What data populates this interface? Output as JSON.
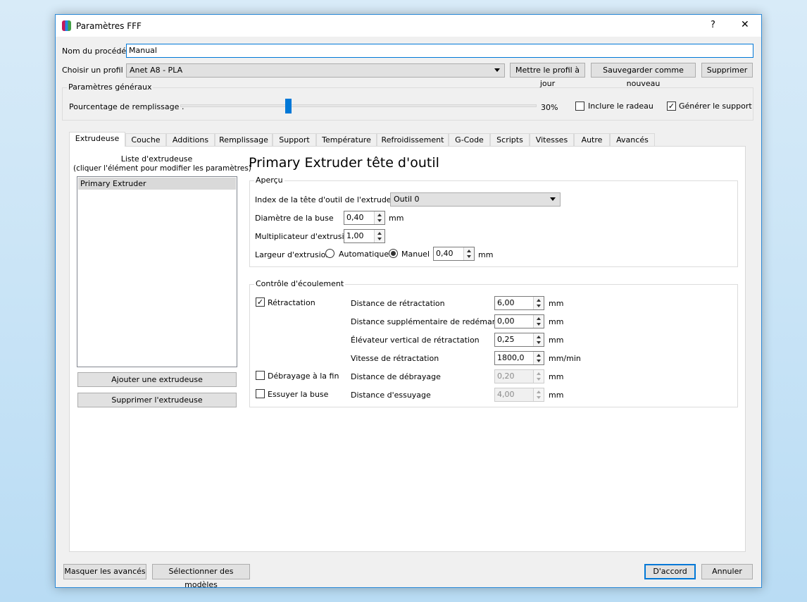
{
  "window": {
    "title": "Paramètres FFF",
    "help": "?",
    "close": "✕"
  },
  "process_name": {
    "label": "Nom du procédé :",
    "value": "Manual"
  },
  "profile": {
    "label": "Choisir un profil :",
    "value": "Anet A8 - PLA",
    "update": "Mettre le profil à jour",
    "save_new": "Sauvegarder comme nouveau",
    "delete": "Supprimer"
  },
  "general": {
    "title": "Paramètres généraux",
    "infill_label": "Pourcentage de remplissage :",
    "infill_value": "30%",
    "infill_percent": 30,
    "raft_label": "Inclure le radeau",
    "raft_checked": false,
    "support_label": "Générer le support",
    "support_checked": true
  },
  "tabs": [
    "Extrudeuse",
    "Couche",
    "Additions",
    "Remplissage",
    "Support",
    "Température",
    "Refroidissement",
    "G-Code",
    "Scripts",
    "Vitesses",
    "Autre",
    "Avancés"
  ],
  "extruder_list": {
    "header1": "Liste d'extrudeuse",
    "header2": "(cliquer l'élément pour modifier les paramètres)",
    "items": [
      "Primary Extruder"
    ],
    "add": "Ajouter une extrudeuse",
    "remove": "Supprimer l'extrudeuse"
  },
  "heading": "Primary Extruder tête d'outil",
  "overview": {
    "title": "Aperçu",
    "toolhead_label": "Index de la tête d'outil de l'extrudeuse",
    "toolhead_value": "Outil 0",
    "nozzle_label": "Diamètre de la buse",
    "nozzle_value": "0,40",
    "nozzle_unit": "mm",
    "mult_label": "Multiplicateur d'extrusion",
    "mult_value": "1,00",
    "width_label": "Largeur d'extrusion",
    "auto": "Automatique",
    "manual": "Manuel",
    "width_value": "0,40",
    "width_unit": "mm"
  },
  "flow": {
    "title": "Contrôle d'écoulement",
    "retraction": "Rétractation",
    "coast": "Débrayage à la fin",
    "wipe": "Essuyer la buse",
    "rows": [
      {
        "label": "Distance de rétractation",
        "value": "6,00",
        "unit": "mm"
      },
      {
        "label": "Distance supplémentaire de redémarrage",
        "value": "0,00",
        "unit": "mm"
      },
      {
        "label": "Élévateur vertical de rétractation",
        "value": "0,25",
        "unit": "mm"
      },
      {
        "label": "Vitesse de rétractation",
        "value": "1800,0",
        "unit": "mm/min"
      },
      {
        "label": "Distance de débrayage",
        "value": "0,20",
        "unit": "mm"
      },
      {
        "label": "Distance d'essuyage",
        "value": "4,00",
        "unit": "mm"
      }
    ]
  },
  "footer": {
    "hide_advanced": "Masquer les avancés",
    "select_models": "Sélectionner des modèles",
    "ok": "D'accord",
    "cancel": "Annuler"
  }
}
